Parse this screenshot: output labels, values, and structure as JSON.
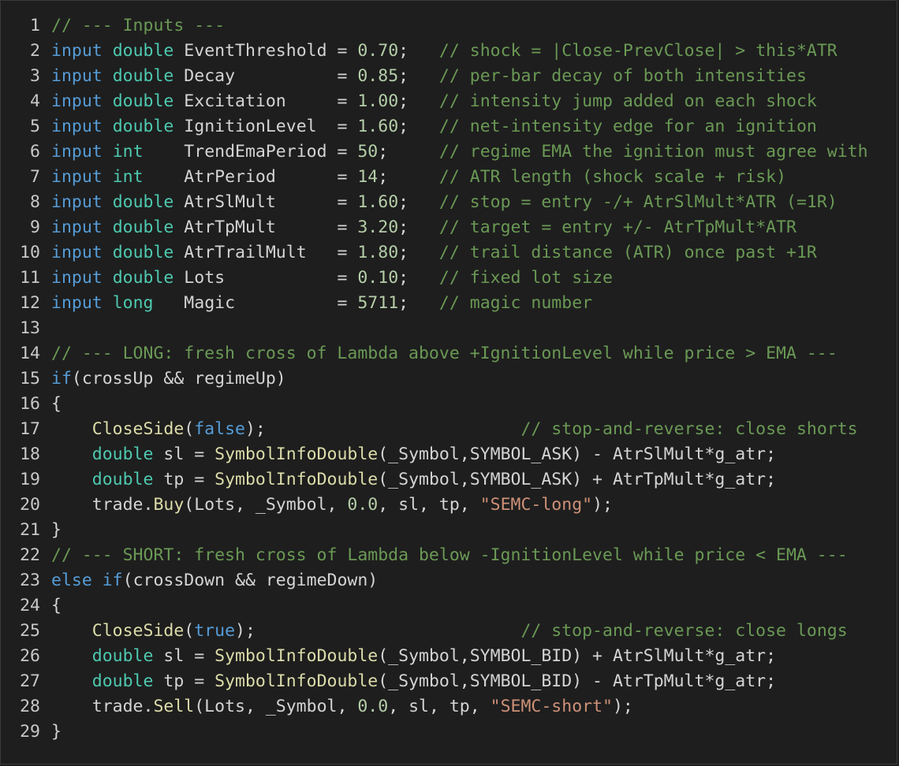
{
  "colors": {
    "background": "#1e1e1e",
    "keyword": "#569cd6",
    "type": "#4ec9b0",
    "function": "#dcdcaa",
    "number": "#b5cea8",
    "string": "#ce9178",
    "comment": "#6a9955",
    "plain": "#d4d4d4"
  },
  "lines": [
    [
      [
        "cm",
        "// --- Inputs ---"
      ]
    ],
    [
      [
        "kw",
        "input"
      ],
      [
        "pl",
        " "
      ],
      [
        "ty",
        "double"
      ],
      [
        "pl",
        " EventThreshold = "
      ],
      [
        "num",
        "0.70"
      ],
      [
        "pl",
        ";   "
      ],
      [
        "cm",
        "// shock = |Close-PrevClose| > this*ATR"
      ]
    ],
    [
      [
        "kw",
        "input"
      ],
      [
        "pl",
        " "
      ],
      [
        "ty",
        "double"
      ],
      [
        "pl",
        " Decay          = "
      ],
      [
        "num",
        "0.85"
      ],
      [
        "pl",
        ";   "
      ],
      [
        "cm",
        "// per-bar decay of both intensities"
      ]
    ],
    [
      [
        "kw",
        "input"
      ],
      [
        "pl",
        " "
      ],
      [
        "ty",
        "double"
      ],
      [
        "pl",
        " Excitation     = "
      ],
      [
        "num",
        "1.00"
      ],
      [
        "pl",
        ";   "
      ],
      [
        "cm",
        "// intensity jump added on each shock"
      ]
    ],
    [
      [
        "kw",
        "input"
      ],
      [
        "pl",
        " "
      ],
      [
        "ty",
        "double"
      ],
      [
        "pl",
        " IgnitionLevel  = "
      ],
      [
        "num",
        "1.60"
      ],
      [
        "pl",
        ";   "
      ],
      [
        "cm",
        "// net-intensity edge for an ignition"
      ]
    ],
    [
      [
        "kw",
        "input"
      ],
      [
        "pl",
        " "
      ],
      [
        "ty",
        "int"
      ],
      [
        "pl",
        "    TrendEmaPeriod = "
      ],
      [
        "num",
        "50"
      ],
      [
        "pl",
        ";     "
      ],
      [
        "cm",
        "// regime EMA the ignition must agree with"
      ]
    ],
    [
      [
        "kw",
        "input"
      ],
      [
        "pl",
        " "
      ],
      [
        "ty",
        "int"
      ],
      [
        "pl",
        "    AtrPeriod      = "
      ],
      [
        "num",
        "14"
      ],
      [
        "pl",
        ";     "
      ],
      [
        "cm",
        "// ATR length (shock scale + risk)"
      ]
    ],
    [
      [
        "kw",
        "input"
      ],
      [
        "pl",
        " "
      ],
      [
        "ty",
        "double"
      ],
      [
        "pl",
        " AtrSlMult      = "
      ],
      [
        "num",
        "1.60"
      ],
      [
        "pl",
        ";   "
      ],
      [
        "cm",
        "// stop = entry -/+ AtrSlMult*ATR (=1R)"
      ]
    ],
    [
      [
        "kw",
        "input"
      ],
      [
        "pl",
        " "
      ],
      [
        "ty",
        "double"
      ],
      [
        "pl",
        " AtrTpMult      = "
      ],
      [
        "num",
        "3.20"
      ],
      [
        "pl",
        ";   "
      ],
      [
        "cm",
        "// target = entry +/- AtrTpMult*ATR"
      ]
    ],
    [
      [
        "kw",
        "input"
      ],
      [
        "pl",
        " "
      ],
      [
        "ty",
        "double"
      ],
      [
        "pl",
        " AtrTrailMult   = "
      ],
      [
        "num",
        "1.80"
      ],
      [
        "pl",
        ";   "
      ],
      [
        "cm",
        "// trail distance (ATR) once past +1R"
      ]
    ],
    [
      [
        "kw",
        "input"
      ],
      [
        "pl",
        " "
      ],
      [
        "ty",
        "double"
      ],
      [
        "pl",
        " Lots           = "
      ],
      [
        "num",
        "0.10"
      ],
      [
        "pl",
        ";   "
      ],
      [
        "cm",
        "// fixed lot size"
      ]
    ],
    [
      [
        "kw",
        "input"
      ],
      [
        "pl",
        " "
      ],
      [
        "ty",
        "long"
      ],
      [
        "pl",
        "   Magic          = "
      ],
      [
        "num",
        "5711"
      ],
      [
        "pl",
        ";   "
      ],
      [
        "cm",
        "// magic number"
      ]
    ],
    [],
    [
      [
        "cm",
        "// --- LONG: fresh cross of Lambda above +IgnitionLevel while price > EMA ---"
      ]
    ],
    [
      [
        "kw",
        "if"
      ],
      [
        "pl",
        "(crossUp && regimeUp)"
      ]
    ],
    [
      [
        "pl",
        "{"
      ]
    ],
    [
      [
        "pl",
        "    "
      ],
      [
        "fn",
        "CloseSide"
      ],
      [
        "pl",
        "("
      ],
      [
        "kw",
        "false"
      ],
      [
        "pl",
        ");                         "
      ],
      [
        "cm",
        "// stop-and-reverse: close shorts"
      ]
    ],
    [
      [
        "pl",
        "    "
      ],
      [
        "ty",
        "double"
      ],
      [
        "pl",
        " sl = "
      ],
      [
        "fn",
        "SymbolInfoDouble"
      ],
      [
        "pl",
        "(_Symbol,SYMBOL_ASK) - AtrSlMult*g_atr;"
      ]
    ],
    [
      [
        "pl",
        "    "
      ],
      [
        "ty",
        "double"
      ],
      [
        "pl",
        " tp = "
      ],
      [
        "fn",
        "SymbolInfoDouble"
      ],
      [
        "pl",
        "(_Symbol,SYMBOL_ASK) + AtrTpMult*g_atr;"
      ]
    ],
    [
      [
        "pl",
        "    trade."
      ],
      [
        "fn",
        "Buy"
      ],
      [
        "pl",
        "(Lots, _Symbol, "
      ],
      [
        "num",
        "0.0"
      ],
      [
        "pl",
        ", sl, tp, "
      ],
      [
        "str",
        "\"SEMC-long\""
      ],
      [
        "pl",
        ");"
      ]
    ],
    [
      [
        "pl",
        "}"
      ]
    ],
    [
      [
        "cm",
        "// --- SHORT: fresh cross of Lambda below -IgnitionLevel while price < EMA ---"
      ]
    ],
    [
      [
        "kw",
        "else"
      ],
      [
        "pl",
        " "
      ],
      [
        "kw",
        "if"
      ],
      [
        "pl",
        "(crossDown && regimeDown)"
      ]
    ],
    [
      [
        "pl",
        "{"
      ]
    ],
    [
      [
        "pl",
        "    "
      ],
      [
        "fn",
        "CloseSide"
      ],
      [
        "pl",
        "("
      ],
      [
        "kw",
        "true"
      ],
      [
        "pl",
        ");                          "
      ],
      [
        "cm",
        "// stop-and-reverse: close longs"
      ]
    ],
    [
      [
        "pl",
        "    "
      ],
      [
        "ty",
        "double"
      ],
      [
        "pl",
        " sl = "
      ],
      [
        "fn",
        "SymbolInfoDouble"
      ],
      [
        "pl",
        "(_Symbol,SYMBOL_BID) + AtrSlMult*g_atr;"
      ]
    ],
    [
      [
        "pl",
        "    "
      ],
      [
        "ty",
        "double"
      ],
      [
        "pl",
        " tp = "
      ],
      [
        "fn",
        "SymbolInfoDouble"
      ],
      [
        "pl",
        "(_Symbol,SYMBOL_BID) - AtrTpMult*g_atr;"
      ]
    ],
    [
      [
        "pl",
        "    trade."
      ],
      [
        "fn",
        "Sell"
      ],
      [
        "pl",
        "(Lots, _Symbol, "
      ],
      [
        "num",
        "0.0"
      ],
      [
        "pl",
        ", sl, tp, "
      ],
      [
        "str",
        "\"SEMC-short\""
      ],
      [
        "pl",
        ");"
      ]
    ],
    [
      [
        "pl",
        "}"
      ]
    ]
  ]
}
